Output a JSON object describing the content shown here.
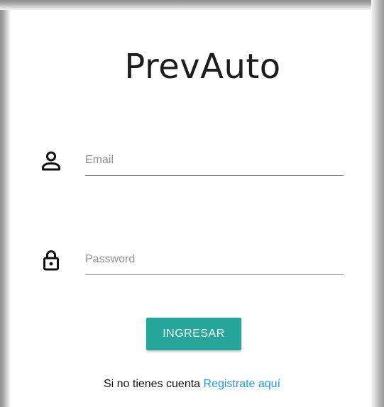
{
  "app": {
    "title": "PrevAuto"
  },
  "login": {
    "email_placeholder": "Email",
    "password_placeholder": "Password",
    "submit_label": "INGRESAR",
    "footer_text": "Si no tienes cuenta",
    "register_link": "Registrate aquí"
  },
  "icons": {
    "email": "person-icon",
    "password": "lock-icon"
  },
  "colors": {
    "button_bg": "#26a69a",
    "link": "#2196f3",
    "title": "#1d1d1d"
  }
}
